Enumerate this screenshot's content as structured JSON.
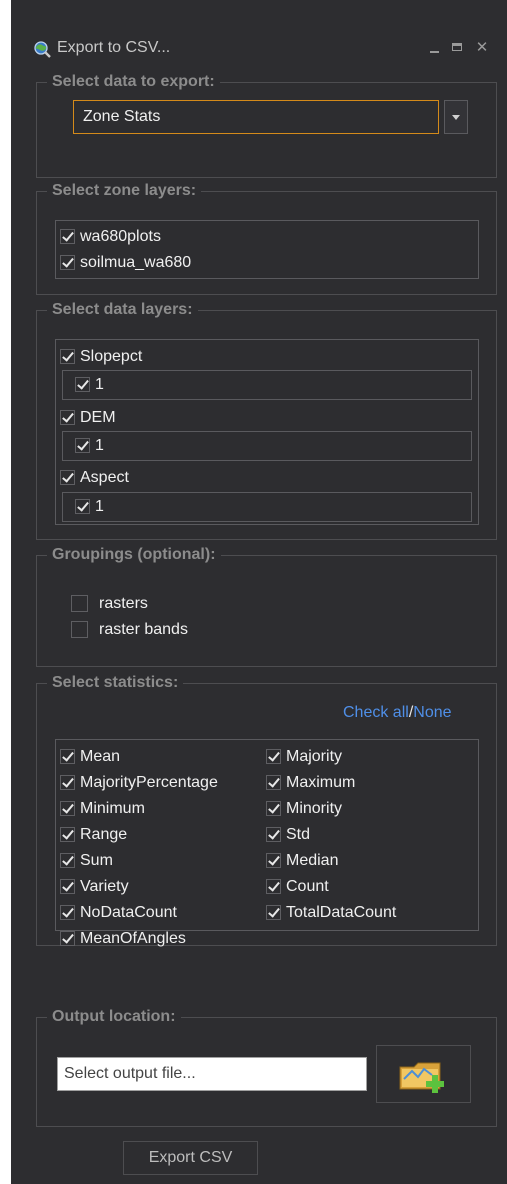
{
  "window": {
    "title": "Export to CSV...",
    "icon": "magnifier-globe-icon"
  },
  "data_section": {
    "legend": "Select data to export:",
    "selected": "Zone Stats"
  },
  "zone_section": {
    "legend": "Select zone layers:",
    "items": [
      {
        "label": "wa680plots",
        "checked": true
      },
      {
        "label": "soilmua_wa680",
        "checked": true
      }
    ]
  },
  "data_layers_section": {
    "legend": "Select data layers:",
    "layers": [
      {
        "label": "Slopepct",
        "checked": true,
        "band": {
          "label": "1",
          "checked": true
        }
      },
      {
        "label": "DEM",
        "checked": true,
        "band": {
          "label": "1",
          "checked": true
        }
      },
      {
        "label": "Aspect",
        "checked": true,
        "band": {
          "label": "1",
          "checked": true
        }
      }
    ]
  },
  "groupings_section": {
    "legend": "Groupings (optional):",
    "items": [
      {
        "label": "rasters",
        "checked": false
      },
      {
        "label": "raster bands",
        "checked": false
      }
    ]
  },
  "stats_section": {
    "legend": "Select statistics:",
    "check_all": "Check all",
    "separator": "/",
    "none": "None",
    "left": [
      {
        "label": "Mean",
        "checked": true
      },
      {
        "label": "MajorityPercentage",
        "checked": true
      },
      {
        "label": "Minimum",
        "checked": true
      },
      {
        "label": "Range",
        "checked": true
      },
      {
        "label": "Sum",
        "checked": true
      },
      {
        "label": "Variety",
        "checked": true
      },
      {
        "label": "NoDataCount",
        "checked": true
      },
      {
        "label": "MeanOfAngles",
        "checked": true
      }
    ],
    "right": [
      {
        "label": "Majority",
        "checked": true
      },
      {
        "label": "Maximum",
        "checked": true
      },
      {
        "label": "Minority",
        "checked": true
      },
      {
        "label": "Std",
        "checked": true
      },
      {
        "label": "Median",
        "checked": true
      },
      {
        "label": "Count",
        "checked": true
      },
      {
        "label": "TotalDataCount",
        "checked": true
      }
    ]
  },
  "output_section": {
    "legend": "Output location:",
    "placeholder": "Select output file...",
    "browse_icon": "folder-add-icon"
  },
  "export_button": "Export CSV"
}
